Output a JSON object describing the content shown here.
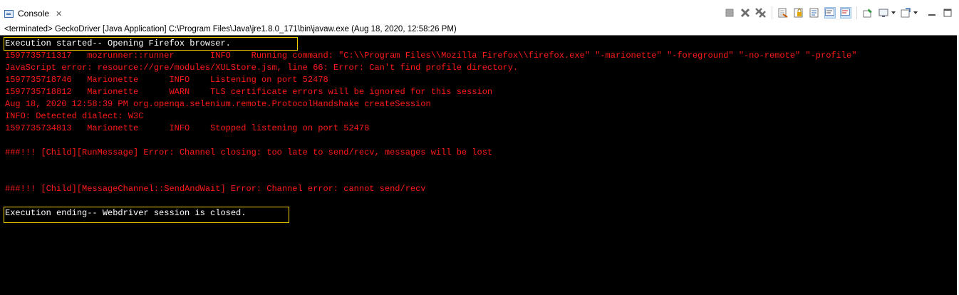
{
  "tab": {
    "icon": "console-icon",
    "label": "Console",
    "close": "✕"
  },
  "toolbar": {
    "icons": [
      "terminate-icon",
      "remove-launch-icon",
      "remove-all-terminated-icon",
      "clear-console-icon",
      "scroll-lock-icon",
      "word-wrap-icon",
      "show-on-stdout-icon",
      "show-on-stderr-icon",
      "pin-console-icon",
      "display-selected-console-icon",
      "open-console-icon",
      "minimize-icon",
      "maximize-icon"
    ]
  },
  "status": "<terminated> GeckoDriver [Java Application] C:\\Program Files\\Java\\jre1.8.0_171\\bin\\javaw.exe (Aug 18, 2020, 12:58:26 PM)",
  "console": {
    "lines": [
      {
        "text": "Execution started-- Opening Firefox browser.",
        "color": "white"
      },
      {
        "text": "1597735711317   mozrunner::runner       INFO    Running command: \"C:\\\\Program Files\\\\Mozilla Firefox\\\\firefox.exe\" \"-marionette\" \"-foreground\" \"-no-remote\" \"-profile\"",
        "color": "red"
      },
      {
        "text": "JavaScript error: resource://gre/modules/XULStore.jsm, line 66: Error: Can't find profile directory.",
        "color": "red"
      },
      {
        "text": "1597735718746   Marionette      INFO    Listening on port 52478",
        "color": "red"
      },
      {
        "text": "1597735718812   Marionette      WARN    TLS certificate errors will be ignored for this session",
        "color": "red"
      },
      {
        "text": "Aug 18, 2020 12:58:39 PM org.openqa.selenium.remote.ProtocolHandshake createSession",
        "color": "red"
      },
      {
        "text": "INFO: Detected dialect: W3C",
        "color": "red"
      },
      {
        "text": "1597735734813   Marionette      INFO    Stopped listening on port 52478",
        "color": "red"
      },
      {
        "text": "",
        "color": "red"
      },
      {
        "text": "###!!! [Child][RunMessage] Error: Channel closing: too late to send/recv, messages will be lost",
        "color": "red"
      },
      {
        "text": "",
        "color": "red"
      },
      {
        "text": "",
        "color": "red"
      },
      {
        "text": "###!!! [Child][MessageChannel::SendAndWait] Error: Channel error: cannot send/recv",
        "color": "red"
      },
      {
        "text": "",
        "color": "red"
      },
      {
        "text": "Execution ending-- Webdriver session is closed.",
        "color": "white"
      }
    ]
  }
}
